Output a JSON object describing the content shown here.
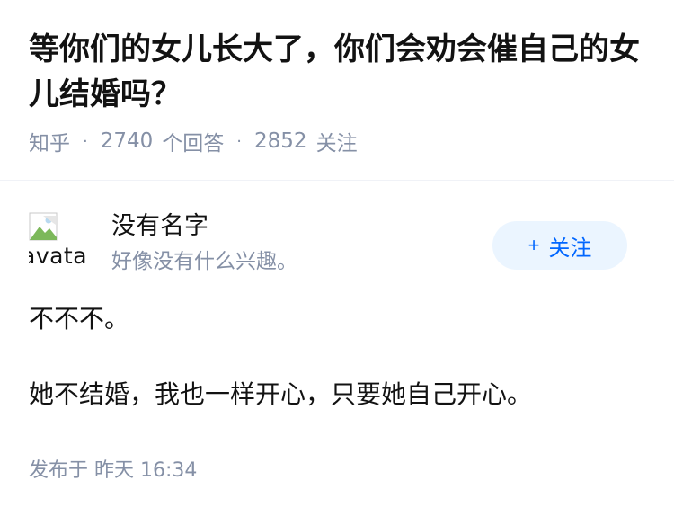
{
  "question": {
    "title": "等你们的女儿长大了，你们会劝会催自己的女儿结婚吗？",
    "source": "知乎",
    "answer_count": "2740",
    "answer_label": "个回答",
    "follower_count": "2852",
    "follower_label": "关注"
  },
  "answer": {
    "author": {
      "avatar_alt": "avatar",
      "name": "没有名字",
      "bio": "好像没有什么兴趣。"
    },
    "follow_button": {
      "plus": "+",
      "label": "关注"
    },
    "paragraphs": [
      "不不不。",
      "她不结婚，我也一样开心，只要她自己开心。"
    ],
    "published": "发布于  昨天 16:34"
  },
  "colors": {
    "text": "#121212",
    "muted": "#8590a6",
    "accent": "#0066ff",
    "accent_bg": "#ebf5ff"
  }
}
